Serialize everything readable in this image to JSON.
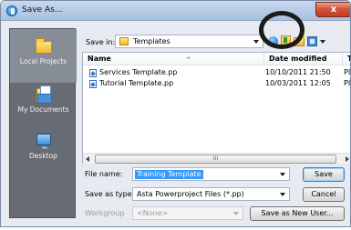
{
  "window": {
    "title": "Save As...",
    "close_glyph": "x"
  },
  "places": [
    {
      "label": "Local Projects",
      "icon": "folder-icon",
      "selected": true
    },
    {
      "label": "My Documents",
      "icon": "my-documents-icon",
      "selected": false
    },
    {
      "label": "Desktop",
      "icon": "desktop-icon",
      "selected": false
    }
  ],
  "lookin": {
    "label": "Save in:",
    "value": "Templates"
  },
  "toolbar": {
    "icons": [
      "back-icon",
      "up-folder-icon",
      "new-folder-icon",
      "views-icon"
    ]
  },
  "filelist": {
    "columns": [
      "Name",
      "Date modified",
      "Ty"
    ],
    "rows": [
      {
        "name": "Services Template.pp",
        "date": "10/10/2011 21:50",
        "type": "PI"
      },
      {
        "name": "Tutorial Template.pp",
        "date": "10/03/2011 12:05",
        "type": "PI"
      }
    ],
    "scroll_grip": "III"
  },
  "form": {
    "filename_label": "File name:",
    "filename_value": "Training Template",
    "filetype_label": "Save as type:",
    "filetype_value": "Asta Powerproject Files (*.pp)",
    "workgroup_label": "Workgroup",
    "workgroup_value": "<None>"
  },
  "buttons": {
    "save": "Save",
    "cancel": "Cancel",
    "save_as_new_user": "Save as New User..."
  },
  "colors": {
    "selection": "#3399ff",
    "places_bg": "#676c74",
    "titlebar": "#b7cbe6",
    "close": "#d3543b"
  }
}
